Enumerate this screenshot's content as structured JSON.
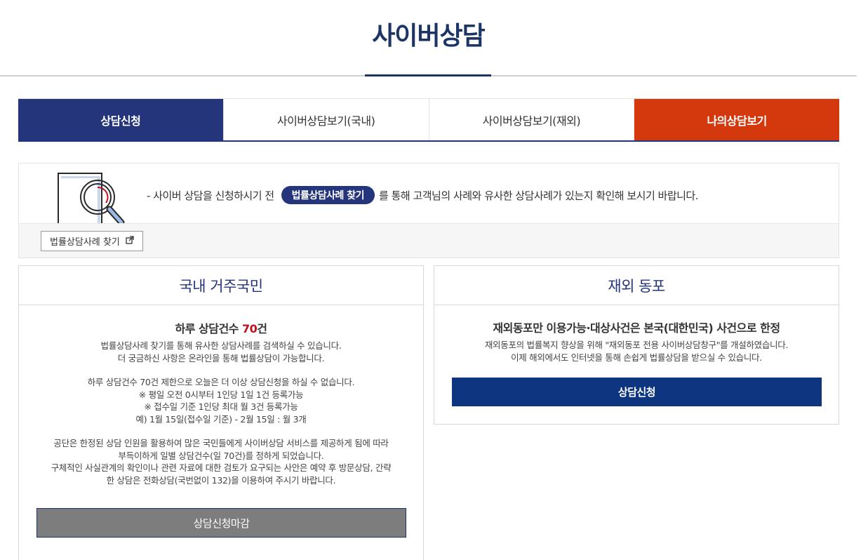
{
  "page": {
    "title": "사이버상담"
  },
  "tabs": [
    {
      "label": "상담신청"
    },
    {
      "label": "사이버상담보기(국내)"
    },
    {
      "label": "사이버상담보기(재외)"
    },
    {
      "label": "나의상담보기"
    }
  ],
  "notice": {
    "text_before": "- 사이버 상담을 신청하시기 전",
    "pill_label": "법률상담사례 찾기",
    "text_after": "를 통해 고객님의 사례와 유사한 상담사례가 있는지 확인해 보시기 바랍니다.",
    "find_button": "법률상담사례 찾기"
  },
  "domestic": {
    "title": "국내 거주국민",
    "subtitle_prefix": "하루 상담건수 ",
    "subtitle_count": "70",
    "subtitle_suffix": "건",
    "para1": [
      "법률상담사례 찾기를 통해 유사한 상담사례를 검색하실 수 있습니다.",
      "더 궁금하신 사항은 온라인을 통해 법률상담이 가능합니다."
    ],
    "para2": [
      "하루 상담건수 70건 제한으로 오늘은 더 이상 상담신청을 하실 수 없습니다.",
      "※ 평일 오전 0시부터 1인당 1일 1건 등록가능",
      "※ 접수일 기준 1인당 최대 월 3건 등록가능",
      "예) 1월 15일(접수일 기준) - 2월 15일 : 월 3개"
    ],
    "para3": [
      "공단은 한정된 상담 인원을 활용하여 많은 국민들에게 사이버상담 서비스를 제공하게 됨에 따라",
      "부득이하게 일별 상담건수(일 70건)를 정하게 되었습니다.",
      "구체적인 사실관계의 확인이나 관련 자료에 대한 검토가 요구되는 사안은 예약 후 방문상담, 간략",
      "한 상담은 전화상담(국번없이 132)을 이용하여 주시기 바랍니다."
    ],
    "button": "상담신청마감"
  },
  "overseas": {
    "title": "재외 동포",
    "subtitle": "재외동포만 이용가능·대상사건은 본국(대한민국) 사건으로 한정",
    "desc": [
      "재외동포의 법률복지 향상을 위해 \"재외동포 전용 사이버상담창구\"를 개설하였습니다.",
      "이제 해외에서도 인터넷을 통해 손쉽게 법률상담을 받으실 수 있습니다."
    ],
    "button": "상담신청"
  },
  "colors": {
    "navy": "#24357c",
    "orange": "#d4380d",
    "title": "#1c3566",
    "closed": "#7d7d7d",
    "apply": "#0d3580"
  },
  "icons": {
    "illustration": "magnifier-document-icon",
    "external": "external-link-icon"
  }
}
